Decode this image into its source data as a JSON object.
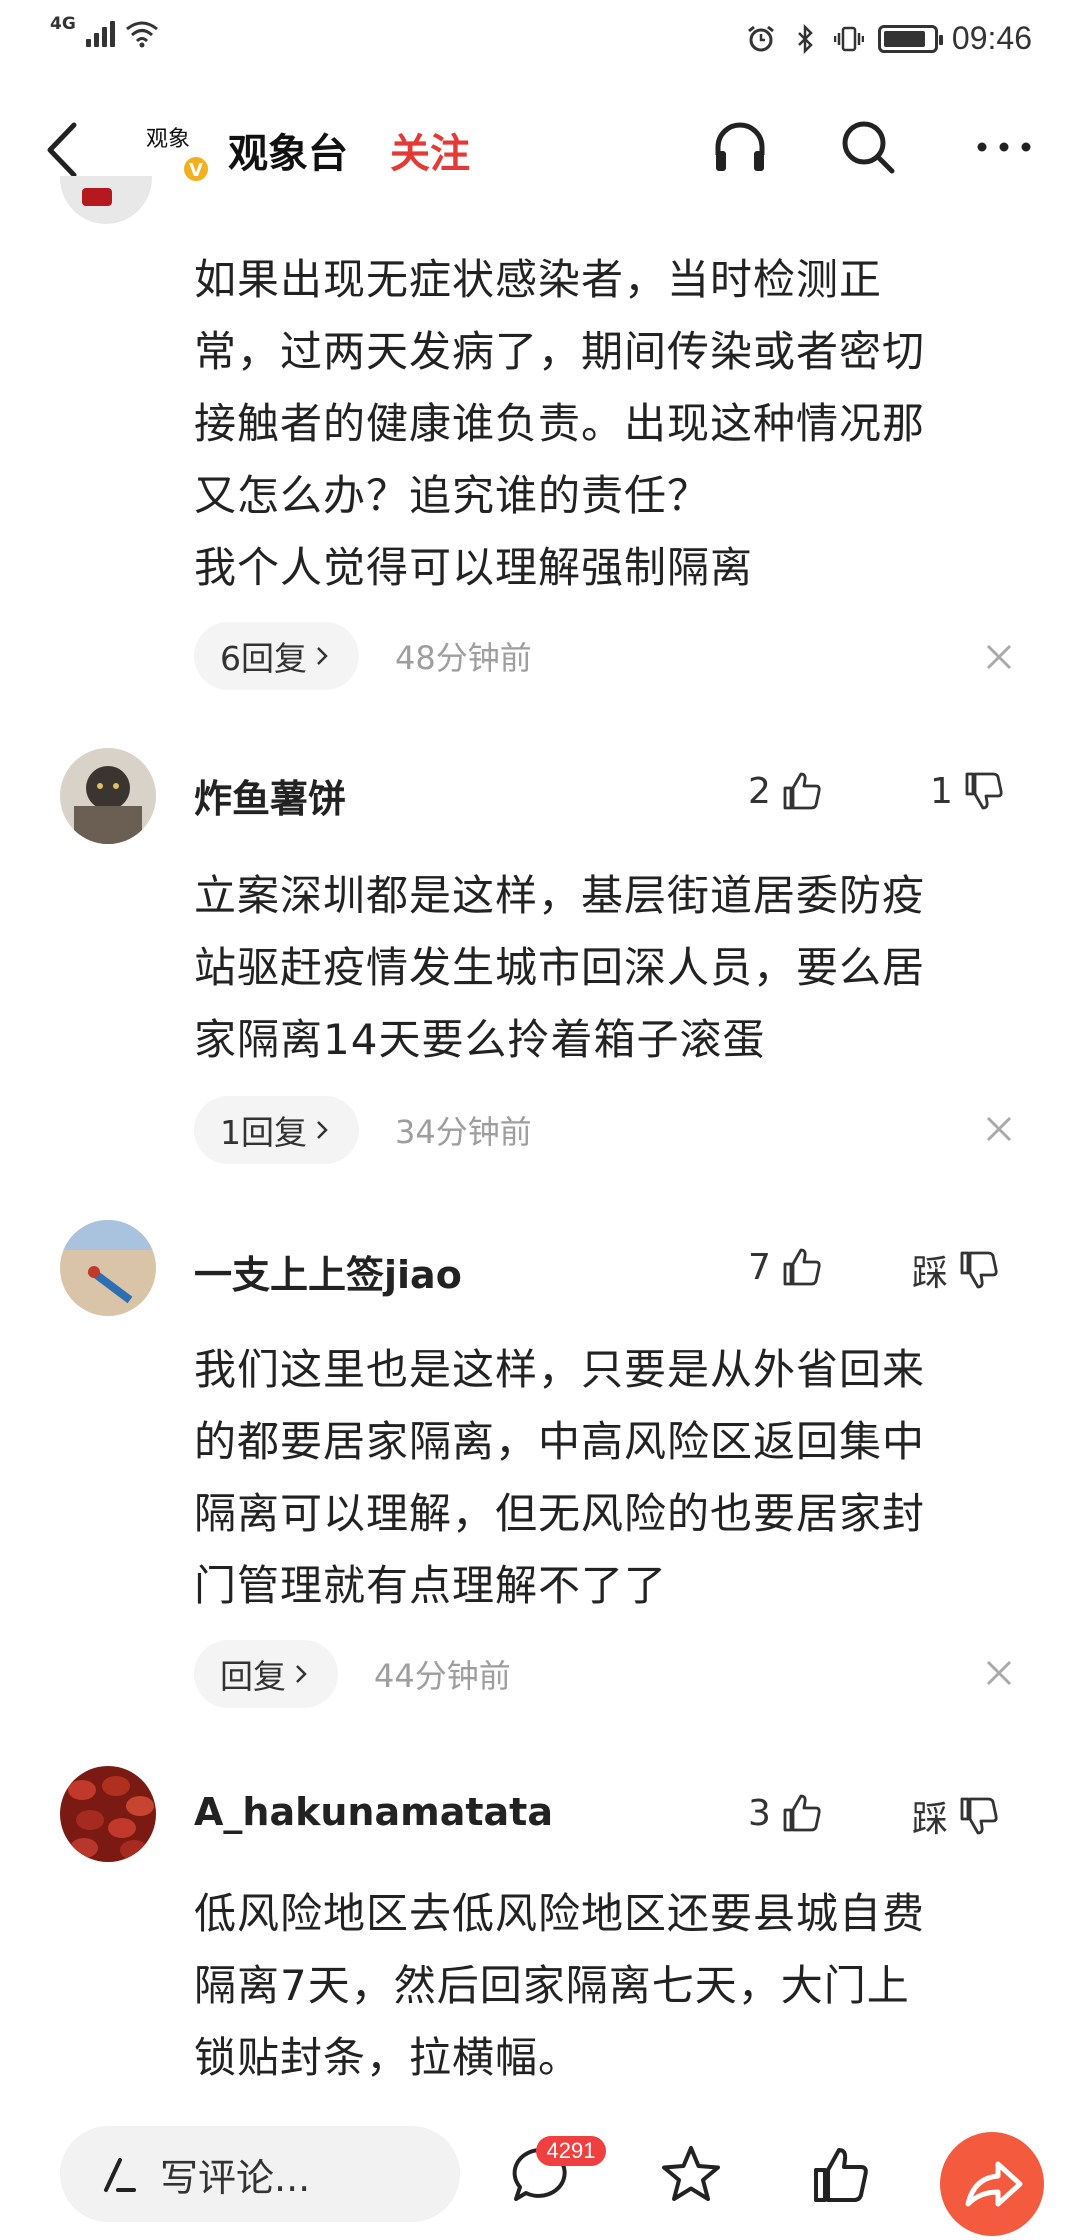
{
  "status_bar": {
    "network": "4G",
    "time": "09:46",
    "battery_level": 0.85
  },
  "header": {
    "logo_text": "观象",
    "verified_badge": "V",
    "account_name": "观象台",
    "follow_label": "关注",
    "icons": [
      "back-icon",
      "headphones-icon",
      "search-icon",
      "more-icon"
    ]
  },
  "comments": [
    {
      "id": "c0",
      "text_lines": [
        "如果出现无症状感染者，当时检测正",
        "常，过两天发病了，期间传染或者密切",
        "接触者的健康谁负责。出现这种情况那",
        "又怎么办？追究谁的责任？",
        "我个人觉得可以理解强制隔离"
      ],
      "reply_label": "6回复",
      "time": "48分钟前"
    },
    {
      "id": "c1",
      "username": "炸鱼薯饼",
      "likes": "2",
      "dislikes": "1",
      "text_lines": [
        "立案深圳都是这样，基层街道居委防疫",
        "站驱赶疫情发生城市回深人员，要么居",
        "家隔离14天要么拎着箱子滚蛋"
      ],
      "reply_label": "1回复",
      "time": "34分钟前"
    },
    {
      "id": "c2",
      "username": "一支上上签jiao",
      "likes": "7",
      "dislikes": "踩",
      "text_lines": [
        "我们这里也是这样，只要是从外省回来",
        "的都要居家隔离，中高风险区返回集中",
        "隔离可以理解，但无风险的也要居家封",
        "门管理就有点理解不了了"
      ],
      "reply_label": "回复",
      "time": "44分钟前"
    },
    {
      "id": "c3",
      "username": "A_hakunamatata",
      "likes": "3",
      "dislikes": "踩",
      "text_lines": [
        "低风险地区去低风险地区还要县城自费",
        "隔离7天，然后回家隔离七天，大门上",
        "锁贴封条，拉横幅。"
      ]
    }
  ],
  "bottom_bar": {
    "input_placeholder": "写评论...",
    "comment_count": "4291",
    "share_color": "#f45a3d"
  },
  "colors": {
    "accent_red": "#e53935",
    "text_gray": "#9e9e9e"
  }
}
